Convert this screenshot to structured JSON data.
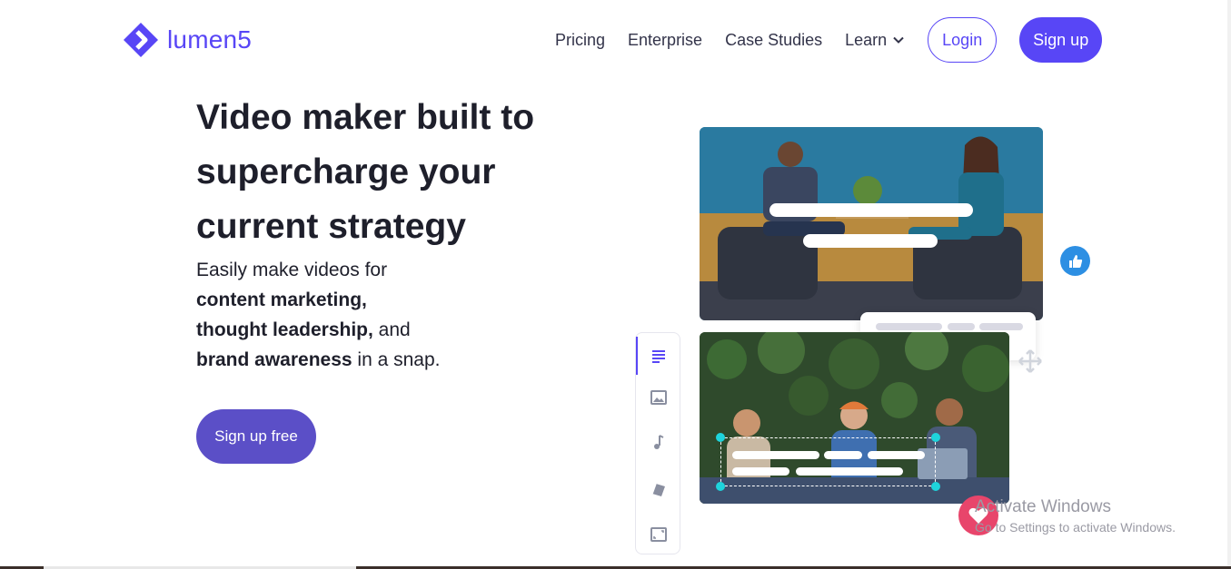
{
  "brand": {
    "name": "lumen5",
    "color": "#5846f6"
  },
  "nav": {
    "links": [
      "Pricing",
      "Enterprise",
      "Case Studies",
      "Learn"
    ],
    "login_label": "Login",
    "signup_label": "Sign up"
  },
  "hero": {
    "title": "Video maker built to supercharge your current strategy",
    "sub_intro": "Easily make videos for",
    "sub_item1": "content marketing,",
    "sub_item2": "thought leadership,",
    "sub_item2_tail": " and",
    "sub_item3": "brand awareness",
    "sub_item3_tail": " in a snap.",
    "cta_label": "Sign up free"
  },
  "editor_sidebar": {
    "icons": [
      "text-icon",
      "image-icon",
      "music-icon",
      "style-icon",
      "format-icon"
    ]
  },
  "watermark": {
    "line1": "Activate Windows",
    "line2": "Go to Settings to activate Windows."
  },
  "colors": {
    "accent": "#5846f6",
    "cta": "#5b4fc7",
    "thumbs": "#2d8fe3",
    "heart": "#e8456b",
    "handle": "#1ed4dc"
  }
}
